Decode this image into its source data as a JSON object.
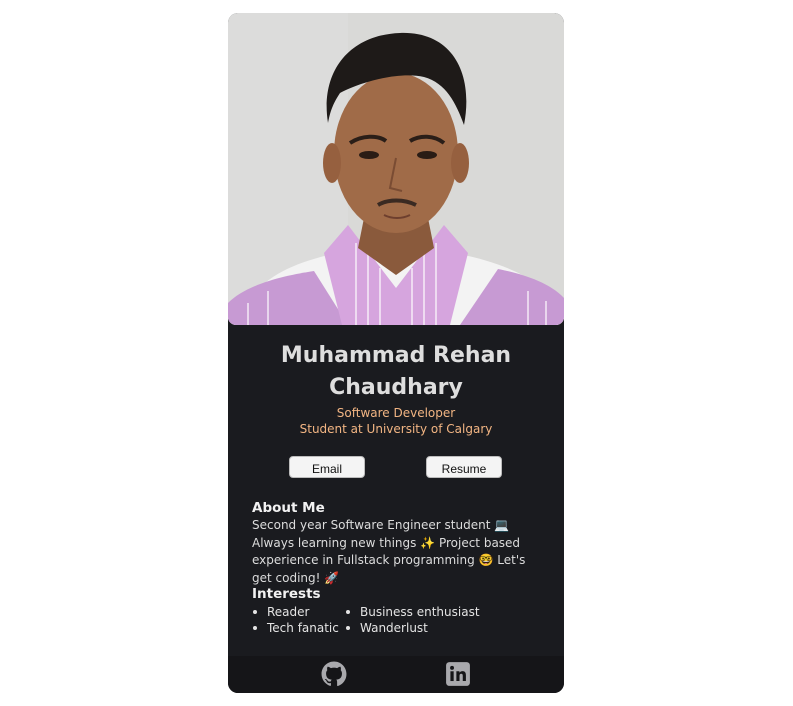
{
  "profile": {
    "name_line1": "Muhammad Rehan",
    "name_line2": "Chaudhary",
    "role": "Software Developer",
    "affiliation": "Student at University of Calgary",
    "photo_alt": "Profile photo"
  },
  "actions": {
    "email_label": "Email",
    "resume_label": "Resume"
  },
  "about": {
    "heading": "About Me",
    "text": "Second year Software Engineer student 💻 Always learning new things ✨ Project based experience in Fullstack programming 🤓 Let's get coding! 🚀"
  },
  "interests": {
    "heading": "Interests",
    "items": [
      "Reader",
      "Tech fanatic",
      "Business enthusiast",
      "Wanderlust"
    ]
  },
  "footer": {
    "icons": [
      "github-icon",
      "linkedin-icon"
    ]
  },
  "colors": {
    "card_background": "#1a1b1f",
    "footer_background": "#151518",
    "accent": "#f2b583",
    "heading_text": "#dedede"
  }
}
